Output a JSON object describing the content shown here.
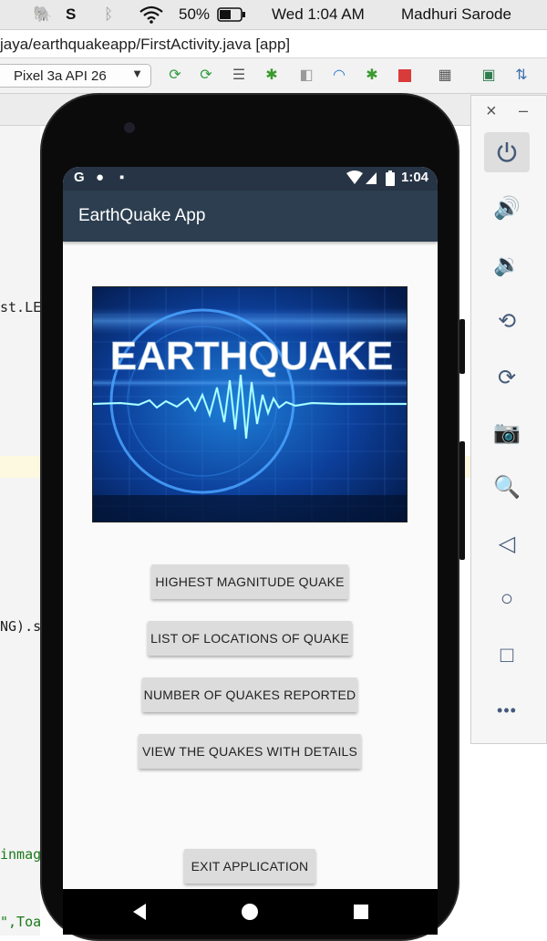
{
  "menubar": {
    "battery": "50%",
    "clock": "Wed 1:04 AM",
    "user": "Madhuri Sarode"
  },
  "ide": {
    "title": "jaya/earthquakeapp/FirstActivity.java [app]",
    "device": "Pixel 3a API 26"
  },
  "editor": {
    "snippets": [
      "st.LE",
      "NG).s",
      "inmag",
      "\",Toa"
    ]
  },
  "phone": {
    "status_icons": [
      "G",
      "●",
      "▪"
    ],
    "time": "1:04",
    "app_title": "EarthQuake App",
    "hero_text": "EARTHQUAKE",
    "buttons": [
      "HIGHEST MAGNITUDE QUAKE",
      "LIST OF LOCATIONS OF QUAKE",
      "NUMBER OF QUAKES REPORTED",
      "VIEW THE QUAKES WITH DETAILS"
    ],
    "exit_button": "EXIT APPLICATION"
  },
  "emulator_panel": {
    "close": "×",
    "minimize": "–",
    "more": "•••"
  },
  "colors": {
    "appbar": "#2c3e50",
    "statusbar": "#263445",
    "button_bg": "#dcdcdc"
  }
}
